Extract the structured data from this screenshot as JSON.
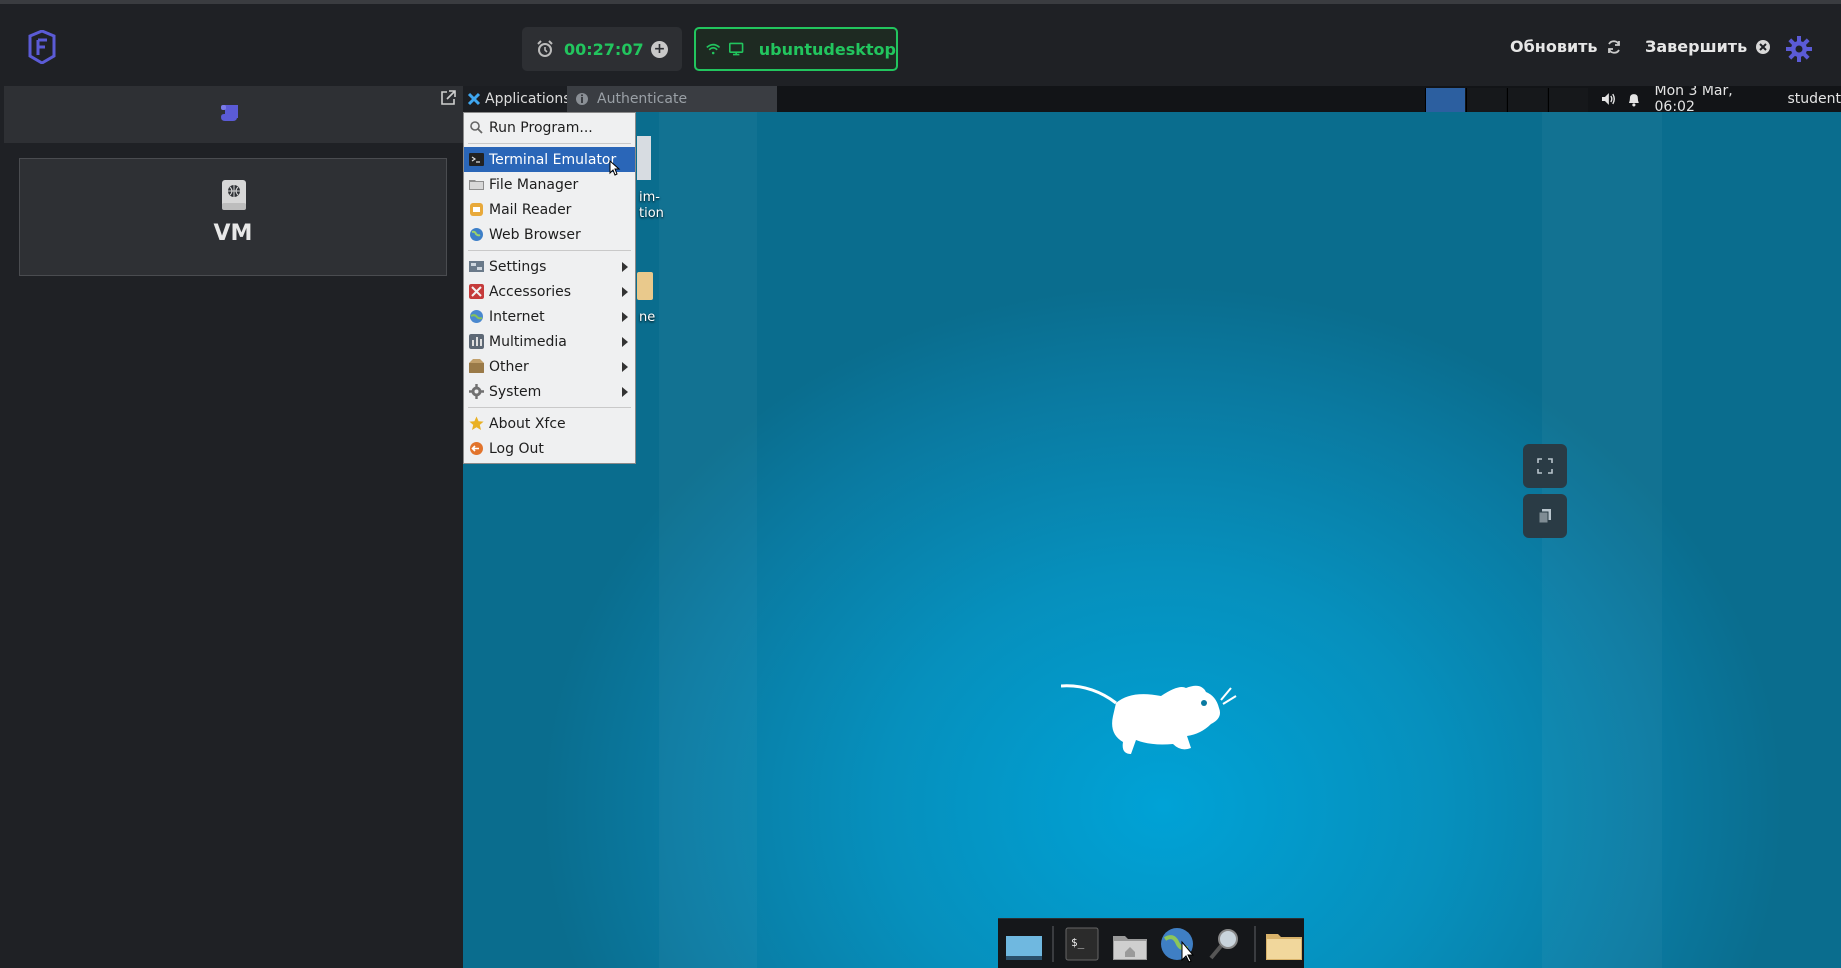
{
  "topbar": {
    "timer": "00:27:07",
    "vm_name": "ubuntudesktop",
    "refresh_label": "Обновить",
    "finish_label": "Завершить"
  },
  "left_panel": {
    "vm_card_label": "VM"
  },
  "xfce_panel": {
    "applications_label": "Applications",
    "task_label": "Authenticate",
    "clock": "Mon  3 Mar, 06:02",
    "user": "student"
  },
  "menu": {
    "items": [
      {
        "label": "Run Program...",
        "icon": "search-icon"
      },
      {
        "label": "Terminal Emulator",
        "icon": "terminal-icon"
      },
      {
        "label": "File Manager",
        "icon": "folder-icon"
      },
      {
        "label": "Mail Reader",
        "icon": "mail-icon"
      },
      {
        "label": "Web Browser",
        "icon": "globe-icon"
      },
      {
        "label": "Settings",
        "icon": "settings-icon"
      },
      {
        "label": "Accessories",
        "icon": "accessories-icon"
      },
      {
        "label": "Internet",
        "icon": "internet-icon"
      },
      {
        "label": "Multimedia",
        "icon": "multimedia-icon"
      },
      {
        "label": "Other",
        "icon": "other-icon"
      },
      {
        "label": "System",
        "icon": "gear-icon"
      },
      {
        "label": "About Xfce",
        "icon": "star-icon"
      },
      {
        "label": "Log Out",
        "icon": "logout-icon"
      }
    ]
  },
  "desktop_icons": {
    "icon1_text": "im-\ntion",
    "icon2_text": "ne"
  },
  "colors": {
    "accent_green": "#22c55e",
    "brand_purple": "#5b5bd6",
    "menu_highlight": "#2a66b8",
    "desktop_blue": "#0690bd"
  }
}
